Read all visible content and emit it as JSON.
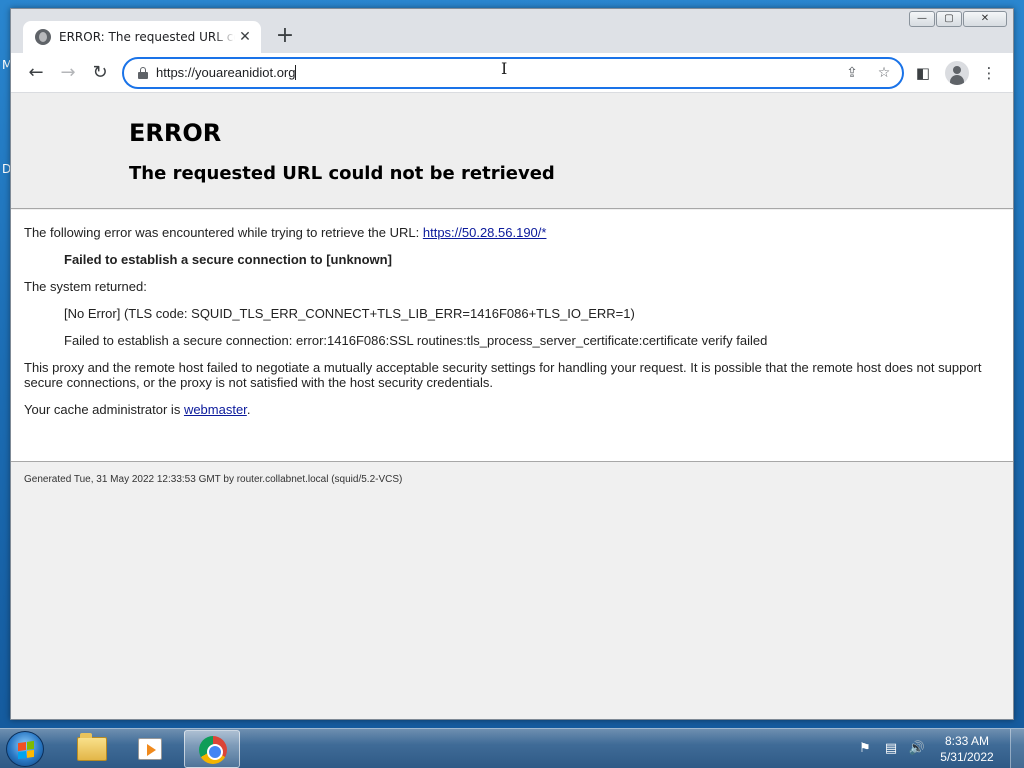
{
  "desktop": {
    "edge_letters": [
      "M",
      "D"
    ]
  },
  "browser": {
    "tab": {
      "title": "ERROR: The requested URL could not be retrieved",
      "favicon": "globe-icon",
      "close_glyph": "✕"
    },
    "newtab_glyph": "+",
    "window_controls": {
      "minimize": "—",
      "maximize": "▢",
      "close": "✕"
    },
    "toolbar": {
      "back_glyph": "←",
      "forward_glyph": "→",
      "reload_glyph": "↻",
      "url": "https://youareanidiot.org",
      "share_glyph": "⇪",
      "bookmark_glyph": "☆",
      "sidepanel_glyph": "◧",
      "menu_glyph": "⋮"
    }
  },
  "page": {
    "h1": "ERROR",
    "h2": "The requested URL could not be retrieved",
    "intro_text": "The following error was encountered while trying to retrieve the URL: ",
    "intro_link": "https://50.28.56.190/*",
    "error_heading": "Failed to establish a secure connection to [unknown]",
    "system_returned": "The system returned:",
    "tls_code": "[No Error] (TLS code: SQUID_TLS_ERR_CONNECT+TLS_LIB_ERR=1416F086+TLS_IO_ERR=1)",
    "ssl_error": "Failed to establish a secure connection: error:1416F086:SSL routines:tls_process_server_certificate:certificate verify failed",
    "proxy_paragraph": "This proxy and the remote host failed to negotiate a mutually acceptable security settings for handling your request. It is possible that the remote host does not support secure connections, or the proxy is not satisfied with the host security credentials.",
    "admin_text": "Your cache administrator is ",
    "admin_link": "webmaster",
    "admin_suffix": ".",
    "footer": "Generated Tue, 31 May 2022 12:33:53 GMT by router.collabnet.local (squid/5.2-VCS)"
  },
  "taskbar": {
    "apps": [
      "windows-explorer",
      "windows-media-player",
      "google-chrome"
    ],
    "active_app": "google-chrome",
    "tray": {
      "action_center_glyph": "⚑",
      "network_glyph": "▤",
      "volume_glyph": "🔊"
    },
    "time": "8:33 AM",
    "date": "5/31/2022"
  },
  "colors": {
    "omnibox_focus": "#1a73e8",
    "link": "#0b1a9b",
    "page_header_bg": "#eeeeee"
  }
}
